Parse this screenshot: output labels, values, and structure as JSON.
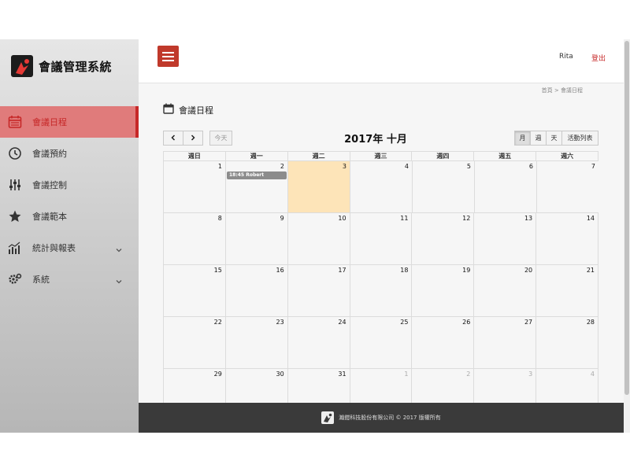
{
  "brand": {
    "title": "會議管理系統",
    "accent": "#c62828"
  },
  "sidebar": {
    "items": [
      {
        "label": "會議日程",
        "icon": "calendar-icon",
        "active": true
      },
      {
        "label": "會議預約",
        "icon": "clock-booking-icon"
      },
      {
        "label": "會議控制",
        "icon": "sliders-icon"
      },
      {
        "label": "會議範本",
        "icon": "star-icon"
      },
      {
        "label": "統計與報表",
        "icon": "bar-chart-icon",
        "expandable": true
      },
      {
        "label": "系統",
        "icon": "gear-icon",
        "expandable": true
      }
    ]
  },
  "header": {
    "user": "Rita",
    "logout": "登出"
  },
  "breadcrumb": "首頁 > 會議日程",
  "page": {
    "title": "會議日程"
  },
  "calendar": {
    "title": "2017年 十月",
    "today_label": "今天",
    "views": [
      "月",
      "週",
      "天",
      "活動列表"
    ],
    "active_view": "月",
    "weekdays": [
      "週日",
      "週一",
      "週二",
      "週三",
      "週四",
      "週五",
      "週六"
    ],
    "weeks": [
      [
        "1",
        "2",
        "3",
        "4",
        "5",
        "6",
        "7"
      ],
      [
        "8",
        "9",
        "10",
        "11",
        "12",
        "13",
        "14"
      ],
      [
        "15",
        "16",
        "17",
        "18",
        "19",
        "20",
        "21"
      ],
      [
        "22",
        "23",
        "24",
        "25",
        "26",
        "27",
        "28"
      ],
      [
        "29",
        "30",
        "31",
        "1",
        "2",
        "3",
        "4"
      ]
    ],
    "today": "3",
    "event": {
      "time": "18:45",
      "name": "Robert",
      "date": "2"
    }
  },
  "footer": {
    "text": "瀚鎧科技股份有限公司 © 2017 版權所有"
  }
}
